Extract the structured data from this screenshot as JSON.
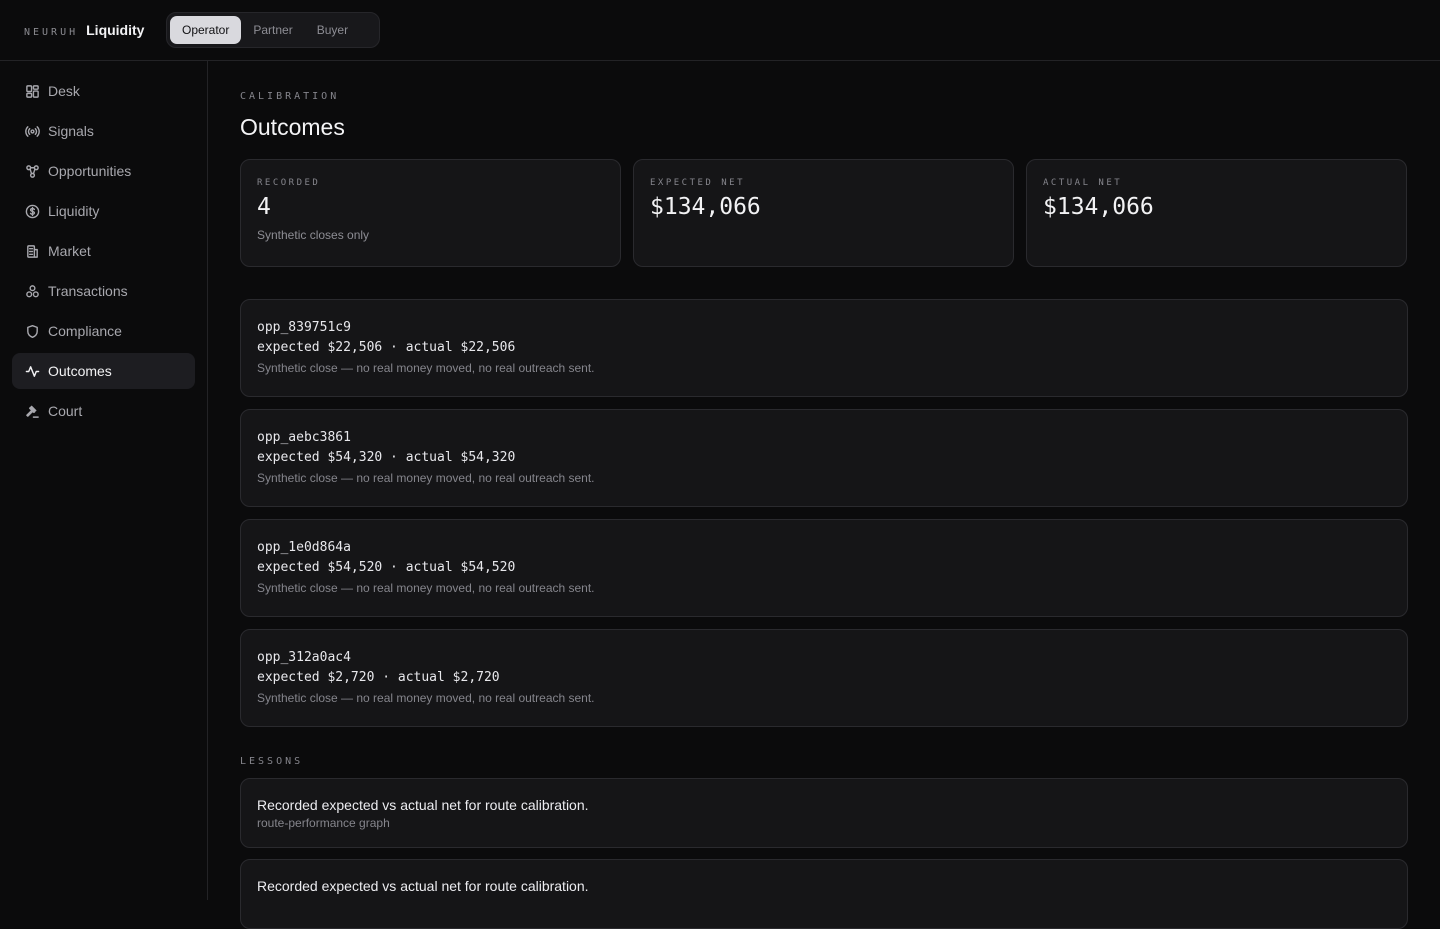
{
  "brand": {
    "org": "NEURUH",
    "product": "Liquidity"
  },
  "roles": [
    {
      "label": "Operator",
      "active": true
    },
    {
      "label": "Partner",
      "active": false
    },
    {
      "label": "Buyer",
      "active": false
    }
  ],
  "sidebar": {
    "items": [
      {
        "label": "Desk",
        "icon": "dashboard-icon"
      },
      {
        "label": "Signals",
        "icon": "radio-signal-icon"
      },
      {
        "label": "Opportunities",
        "icon": "network-icon"
      },
      {
        "label": "Liquidity",
        "icon": "dollar-circle-icon"
      },
      {
        "label": "Market",
        "icon": "building-icon"
      },
      {
        "label": "Transactions",
        "icon": "cluster-icon"
      },
      {
        "label": "Compliance",
        "icon": "shield-icon"
      },
      {
        "label": "Outcomes",
        "icon": "activity-icon",
        "active": true
      },
      {
        "label": "Court",
        "icon": "gavel-icon"
      }
    ]
  },
  "page": {
    "eyebrow": "CALIBRATION",
    "title": "Outcomes"
  },
  "stats": [
    {
      "label": "RECORDED",
      "value": "4",
      "sub": "Synthetic closes only"
    },
    {
      "label": "EXPECTED NET",
      "value": "$134,066",
      "sub": ""
    },
    {
      "label": "ACTUAL NET",
      "value": "$134,066",
      "sub": ""
    }
  ],
  "outcomes": [
    {
      "id": "opp_839751c9",
      "amounts": "expected $22,506 · actual $22,506",
      "note": "Synthetic close — no real money moved, no real outreach sent."
    },
    {
      "id": "opp_aebc3861",
      "amounts": "expected $54,320 · actual $54,320",
      "note": "Synthetic close — no real money moved, no real outreach sent."
    },
    {
      "id": "opp_1e0d864a",
      "amounts": "expected $54,520 · actual $54,520",
      "note": "Synthetic close — no real money moved, no real outreach sent."
    },
    {
      "id": "opp_312a0ac4",
      "amounts": "expected $2,720 · actual $2,720",
      "note": "Synthetic close — no real money moved, no real outreach sent."
    }
  ],
  "lessons": {
    "label": "LESSONS",
    "items": [
      {
        "title": "Recorded expected vs actual net for route calibration.",
        "sub": "route-performance graph"
      },
      {
        "title": "Recorded expected vs actual net for route calibration.",
        "sub": ""
      }
    ]
  }
}
